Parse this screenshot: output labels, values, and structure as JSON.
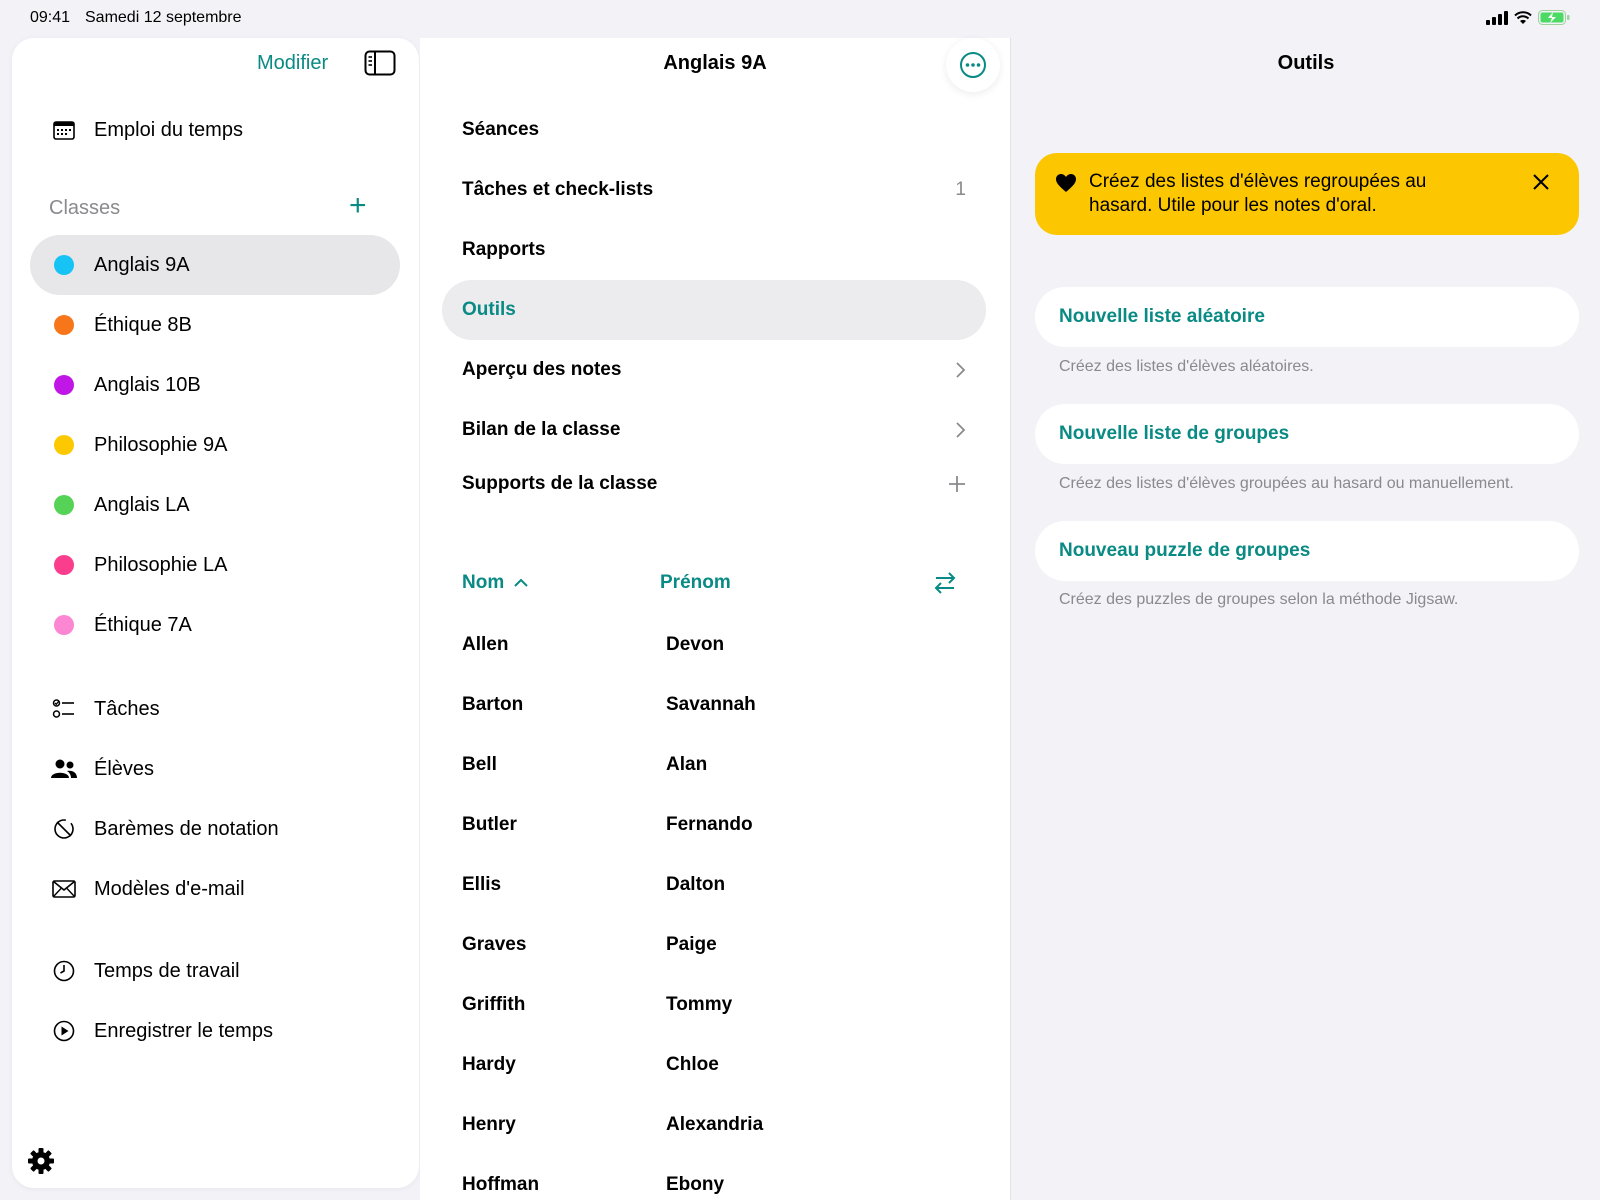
{
  "status": {
    "time": "09:41",
    "date": "Samedi 12 septembre"
  },
  "sidebar": {
    "edit_label": "Modifier",
    "schedule": "Emploi du temps",
    "classes_label": "Classes",
    "classes": [
      {
        "label": "Anglais 9A",
        "color": "#17c2f5"
      },
      {
        "label": "Éthique 8B",
        "color": "#f8761a"
      },
      {
        "label": "Anglais 10B",
        "color": "#c117e6"
      },
      {
        "label": "Philosophie 9A",
        "color": "#fcc800"
      },
      {
        "label": "Anglais LA",
        "color": "#56d257"
      },
      {
        "label": "Philosophie LA",
        "color": "#fb3d8d"
      },
      {
        "label": "Éthique 7A",
        "color": "#fb86d2"
      }
    ],
    "items": [
      "Tâches",
      "Élèves",
      "Barèmes de notation",
      "Modèles d'e-mail"
    ],
    "time_items": [
      "Temps de travail",
      "Enregistrer le temps"
    ]
  },
  "middle": {
    "title": "Anglais 9A",
    "menu": [
      {
        "label": "Séances",
        "trail": ""
      },
      {
        "label": "Tâches et check-lists",
        "trail": "1"
      },
      {
        "label": "Rapports",
        "trail": ""
      },
      {
        "label": "Outils",
        "trail": ""
      },
      {
        "label": "Aperçu des notes",
        "trail": ""
      },
      {
        "label": "Bilan de la classe",
        "trail": ""
      },
      {
        "label": "Supports de la classe",
        "trail": ""
      }
    ],
    "col_last": "Nom",
    "col_first": "Prénom",
    "students": [
      {
        "last": "Allen",
        "first": "Devon"
      },
      {
        "last": "Barton",
        "first": "Savannah"
      },
      {
        "last": "Bell",
        "first": "Alan"
      },
      {
        "last": "Butler",
        "first": "Fernando"
      },
      {
        "last": "Ellis",
        "first": "Dalton"
      },
      {
        "last": "Graves",
        "first": "Paige"
      },
      {
        "last": "Griffith",
        "first": "Tommy"
      },
      {
        "last": "Hardy",
        "first": "Chloe"
      },
      {
        "last": "Henry",
        "first": "Alexandria"
      },
      {
        "last": "Hoffman",
        "first": "Ebony"
      }
    ]
  },
  "detail": {
    "title": "Outils",
    "banner": "Créez des listes d'élèves regroupées au hasard. Utile pour les notes d'oral.",
    "tools": [
      {
        "label": "Nouvelle liste aléatoire",
        "desc": "Créez des listes d'élèves aléatoires."
      },
      {
        "label": "Nouvelle liste de groupes",
        "desc": "Créez des listes d'élèves groupées au hasard ou manuellement."
      },
      {
        "label": "Nouveau puzzle de groupes",
        "desc": "Créez des puzzles de groupes selon la méthode Jigsaw."
      }
    ]
  },
  "accent_color": "#0a8a84",
  "banner_color": "#fcc600"
}
